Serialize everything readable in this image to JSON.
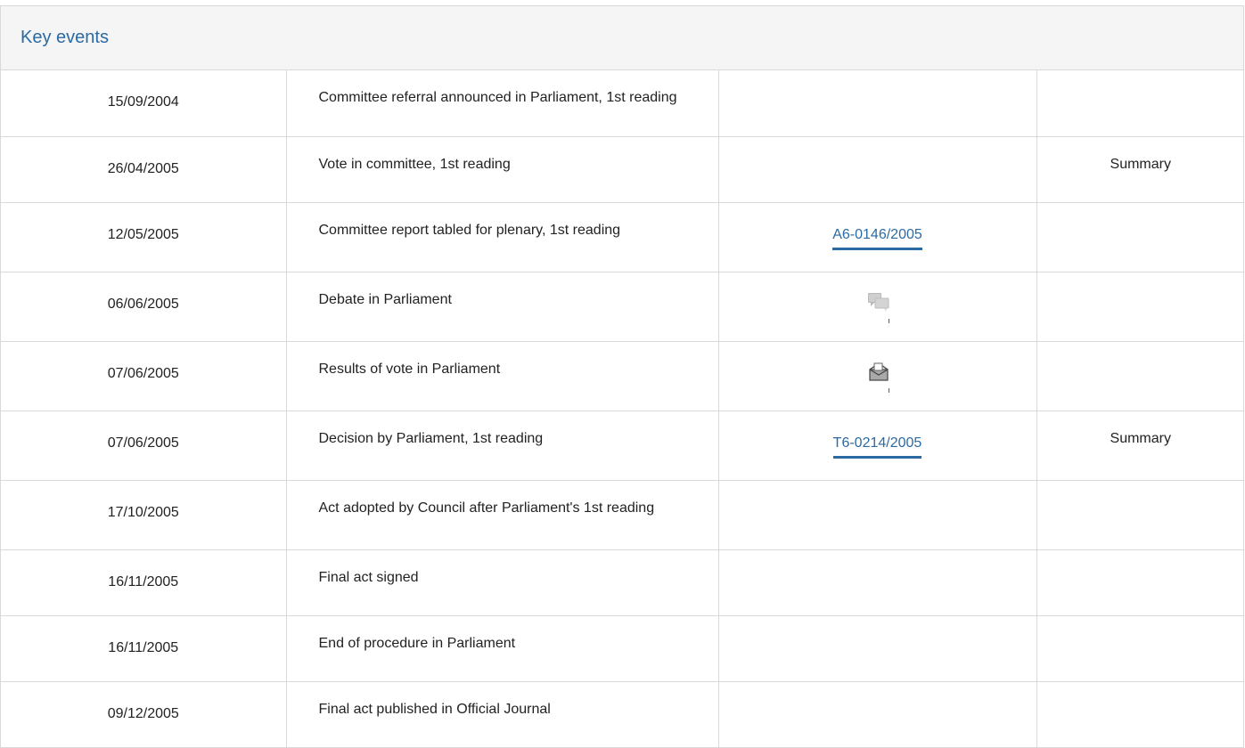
{
  "panel": {
    "title": "Key events"
  },
  "events": [
    {
      "date": "15/09/2004",
      "event": "Committee referral announced in Parliament, 1st reading",
      "doc": null,
      "doc_icon": null,
      "summary": ""
    },
    {
      "date": "26/04/2005",
      "event": "Vote in committee, 1st reading",
      "doc": null,
      "doc_icon": null,
      "summary": "Summary"
    },
    {
      "date": "12/05/2005",
      "event": "Committee report tabled for plenary, 1st reading",
      "doc": "A6-0146/2005",
      "doc_icon": null,
      "summary": ""
    },
    {
      "date": "06/06/2005",
      "event": "Debate in Parliament",
      "doc": null,
      "doc_icon": "debate-icon",
      "summary": ""
    },
    {
      "date": "07/06/2005",
      "event": "Results of vote in Parliament",
      "doc": null,
      "doc_icon": "vote-results-icon",
      "summary": ""
    },
    {
      "date": "07/06/2005",
      "event": "Decision by Parliament, 1st reading",
      "doc": "T6-0214/2005",
      "doc_icon": null,
      "summary": "Summary"
    },
    {
      "date": "17/10/2005",
      "event": "Act adopted by Council after Parliament's 1st reading",
      "doc": null,
      "doc_icon": null,
      "summary": ""
    },
    {
      "date": "16/11/2005",
      "event": "Final act signed",
      "doc": null,
      "doc_icon": null,
      "summary": ""
    },
    {
      "date": "16/11/2005",
      "event": "End of procedure in Parliament",
      "doc": null,
      "doc_icon": null,
      "summary": ""
    },
    {
      "date": "09/12/2005",
      "event": "Final act published in Official Journal",
      "doc": null,
      "doc_icon": null,
      "summary": ""
    }
  ],
  "colors": {
    "link": "#2b6aa3",
    "border": "#d9d9d9",
    "header_bg": "#f5f5f5"
  }
}
